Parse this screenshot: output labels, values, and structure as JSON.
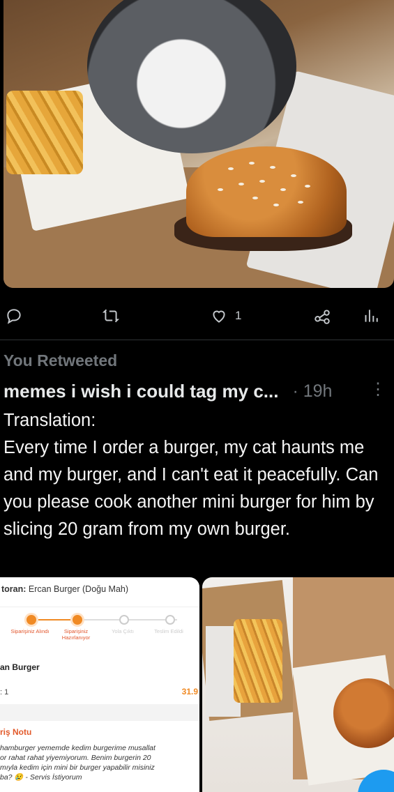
{
  "actions": {
    "like_count": "1"
  },
  "retweet_label": "You Retweeted",
  "tweet": {
    "author_name": "memes i wish i could tag my c...",
    "time": "· 19h",
    "text": "Translation:\nEvery time I order a burger, my cat haunts me and my burger, and I can't eat it peacefully. Can you please cook another mini burger for him by slicing 20 gram from my own burger."
  },
  "receipt": {
    "restaurant_label": "toran:",
    "restaurant_name": "Ercan Burger (Doğu Mah)",
    "steps": [
      "Siparişiniz Alındı",
      "Siparişiniz Hazırlanıyor",
      "Yola Çıktı",
      "Teslim Edildi"
    ],
    "item_name": "an Burger",
    "item_qty": ": 1",
    "item_price": "31.9",
    "note_title": "riş Notu",
    "note_text": "hamburger yememde kedim burgerime musallat\nor rahat rahat yiyemiyorum. Benim burgerin 20\nmıyla kedim için mini bir burger yapabilir misiniz\nba? 😢 - Servis İstiyorum"
  },
  "icons": {
    "reply": "reply-icon",
    "retweet": "retweet-icon",
    "like": "heart-icon",
    "share": "share-icon",
    "analytics": "analytics-icon",
    "more": "more-vertical-icon"
  },
  "colors": {
    "accent": "#1d9bf0",
    "muted": "#71767b",
    "receipt_accent": "#f08a24"
  }
}
